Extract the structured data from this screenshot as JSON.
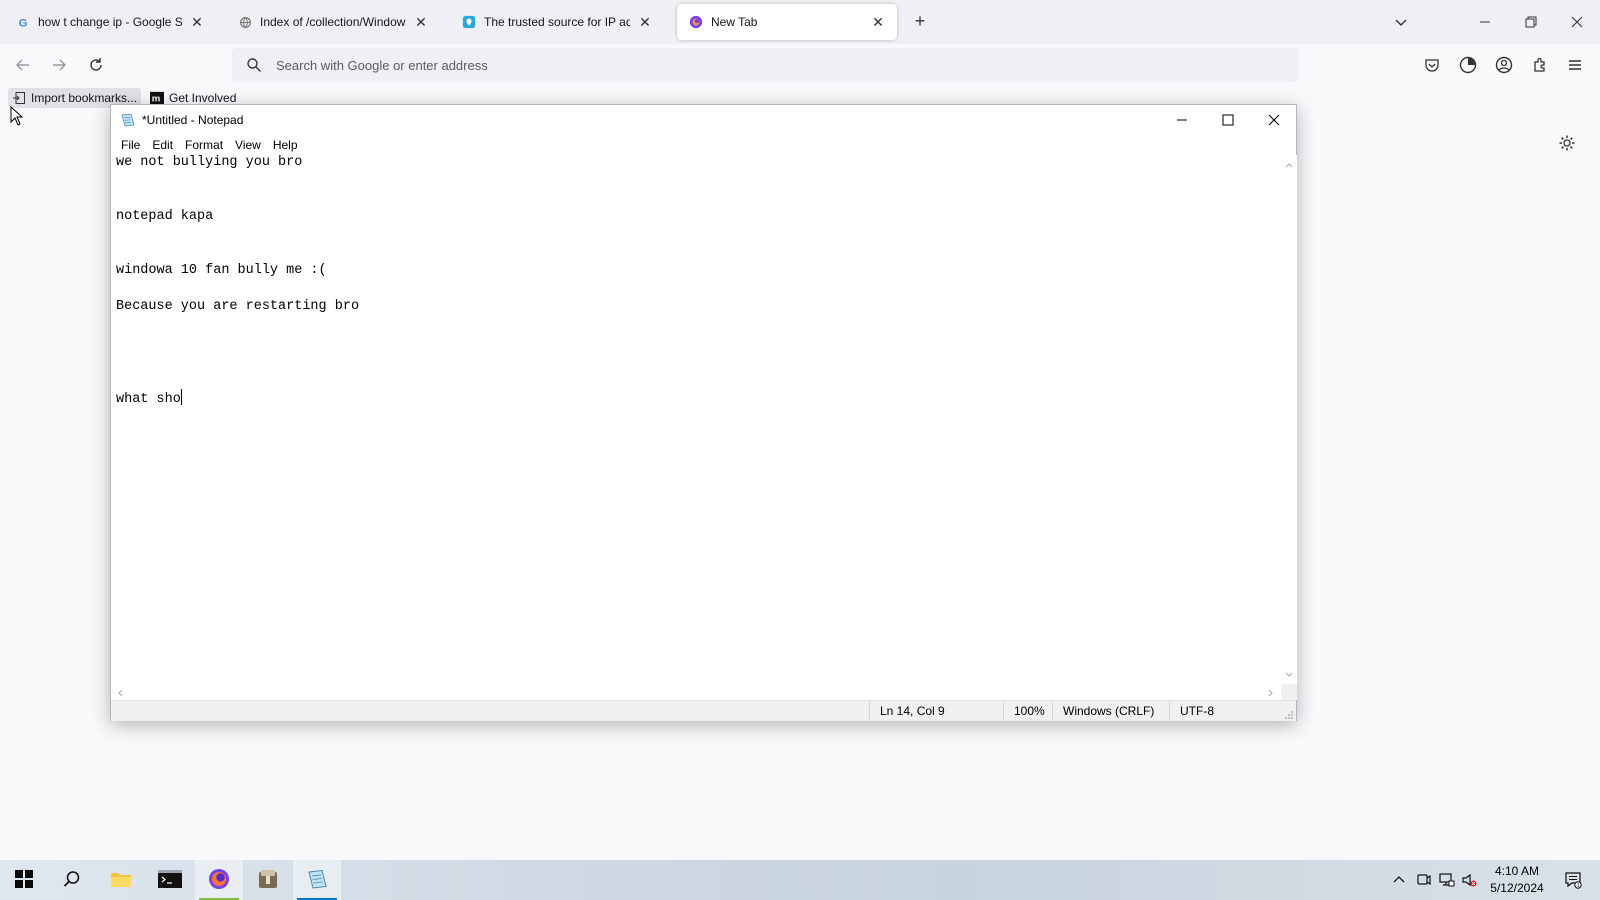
{
  "browser": {
    "tabs": [
      {
        "title": "how t change ip - Google Search",
        "active": false,
        "favicon": "google-icon"
      },
      {
        "title": "Index of /collection/Windows E",
        "active": false,
        "favicon": "globe-icon"
      },
      {
        "title": "The trusted source for IP address",
        "active": false,
        "favicon": "location-pin-icon"
      },
      {
        "title": "New Tab",
        "active": true,
        "favicon": "firefox-icon"
      }
    ],
    "address_placeholder": "Search with Google or enter address",
    "bookmarks": [
      {
        "label": "Import bookmarks...",
        "icon": "import-icon"
      },
      {
        "label": "Get Involved",
        "icon": "mdn-icon"
      }
    ]
  },
  "notepad": {
    "title": "*Untitled - Notepad",
    "menu": [
      "File",
      "Edit",
      "Format",
      "View",
      "Help"
    ],
    "lines": [
      "we not bullying you bro",
      "notepad kapa",
      "windowa 10 fan bully me :(",
      "Because you are restarting bro",
      "what sho"
    ],
    "status": {
      "position": "Ln 14, Col 9",
      "zoom": "100%",
      "line_ending": "Windows (CRLF)",
      "encoding": "UTF-8"
    }
  },
  "taskbar": {
    "apps": [
      "start-icon",
      "search-icon",
      "file-explorer-icon",
      "terminal-icon",
      "firefox-icon",
      "archive-icon",
      "notepad-icon"
    ],
    "time": "4:10 AM",
    "date": "5/12/2024"
  },
  "colors": {
    "accent": "#0078d4",
    "browser_bg": "#f9f9fb",
    "tabstrip_bg": "#f0f0f4"
  }
}
